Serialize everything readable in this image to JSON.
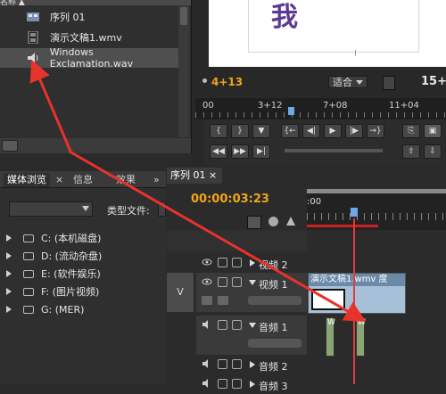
{
  "project": {
    "header": "名称 ▲",
    "items": [
      {
        "label": "序列 01",
        "icon": "sequence-icon"
      },
      {
        "label": "演示文稿1.wmv",
        "icon": "film-icon"
      },
      {
        "label": "Windows Exclamation.wav",
        "icon": "speaker-icon"
      }
    ]
  },
  "monitor": {
    "glyph": "我",
    "crosshair": "╷",
    "timecode_left": "4+13",
    "fit_label": "适合",
    "timecode_right": "15+",
    "ruler_ticks": [
      "00",
      "3+12",
      "7+08",
      "11+04"
    ]
  },
  "browser": {
    "tabs": [
      "媒体浏览",
      "信息",
      "效果"
    ],
    "tab_close": "×",
    "tab_more": "»",
    "file_type_label": "类型文件:",
    "drives": [
      "C: (本机磁盘)",
      "D: (流动杂盘)",
      "E: (软件娱乐)",
      "F: (图片视频)",
      "G: (MER)"
    ]
  },
  "timeline": {
    "tab_label": "序列 01",
    "tab_close": "×",
    "timecode": "00:00:03:23",
    "ruler_start": ":00",
    "tracks": [
      {
        "name": "视频 2"
      },
      {
        "name": "视频 1"
      },
      {
        "name": "音频 1"
      },
      {
        "name": "音频 2"
      },
      {
        "name": "音频 3"
      }
    ],
    "target_label": "V",
    "video_clip_title": "演示文稿1.wmv 度",
    "audio_clip_marker": "W"
  }
}
